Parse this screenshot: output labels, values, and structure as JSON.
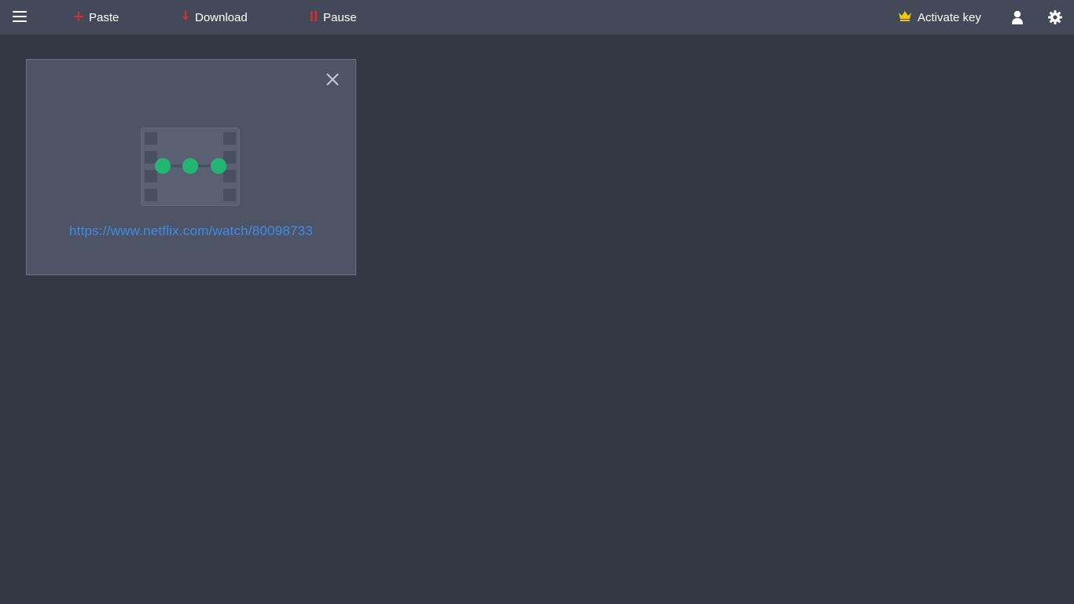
{
  "toolbar": {
    "menu_icon": "hamburger-icon",
    "paste_label": "Paste",
    "paste_icon": "plus-icon",
    "download_label": "Download",
    "download_icon": "arrow-down-icon",
    "pause_label": "Pause",
    "pause_icon": "pause-icon",
    "activate_label": "Activate key",
    "activate_icon": "crown-icon",
    "user_icon": "user-icon",
    "settings_icon": "gear-icon"
  },
  "download_item": {
    "url": "https://www.netflix.com/watch/80098733",
    "thumbnail_icon": "film-loading-icon",
    "close_icon": "close-icon"
  },
  "colors": {
    "background": "#333844",
    "toolbar": "#434958",
    "card": "#4e5466",
    "accent_red": "#d32f2f",
    "crown_yellow": "#f2c811",
    "link_blue": "#3b8de8",
    "loading_green": "#22b573"
  }
}
